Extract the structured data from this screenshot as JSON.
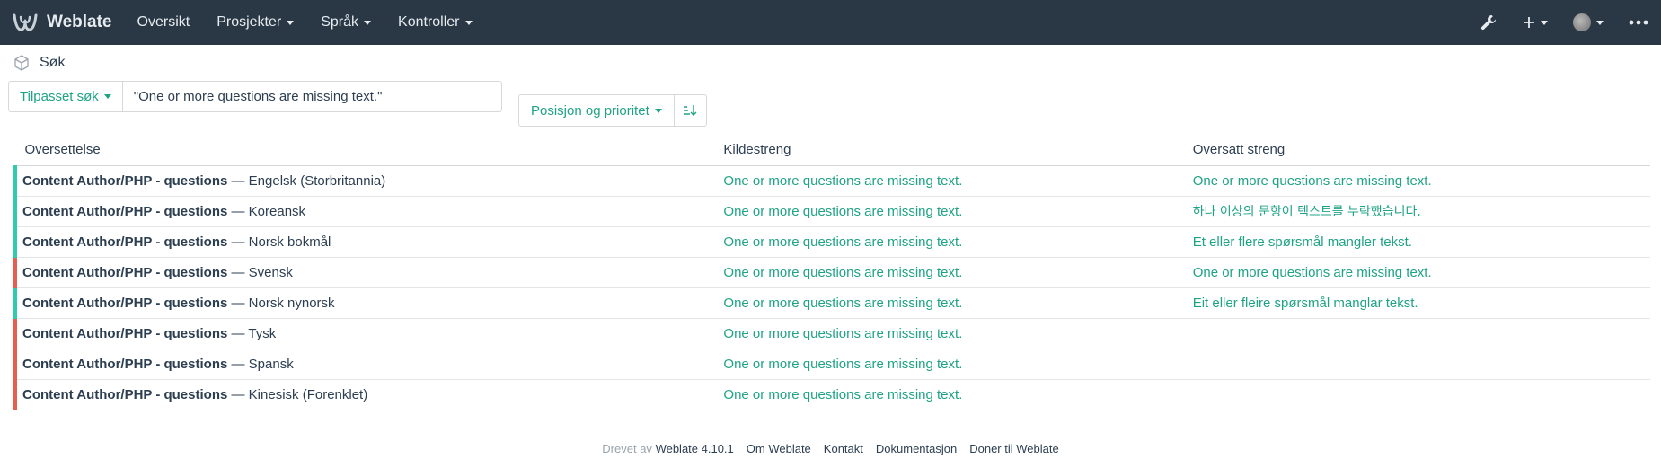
{
  "navbar": {
    "brand": "Weblate",
    "items": [
      {
        "label": "Oversikt",
        "dropdown": false
      },
      {
        "label": "Prosjekter",
        "dropdown": true
      },
      {
        "label": "Språk",
        "dropdown": true
      },
      {
        "label": "Kontroller",
        "dropdown": true
      }
    ],
    "right_icons": [
      "wrench-icon",
      "plus-icon",
      "avatar",
      "more-icon"
    ]
  },
  "breadcrumb": {
    "icon": "cube-icon",
    "label": "Søk"
  },
  "search": {
    "custom_search_label": "Tilpasset søk",
    "query_value": "\"One or more questions are missing text.\"",
    "sort_label": "Posisjon og prioritet",
    "sort_direction_icon": "sort-ascending-icon"
  },
  "table": {
    "headers": [
      "Oversettelse",
      "Kildestreng",
      "Oversatt streng"
    ],
    "separator": " — ",
    "rows": [
      {
        "component": "Content Author/PHP - questions",
        "language": "Engelsk (Storbritannia)",
        "source": "One or more questions are missing text.",
        "translation": "One or more questions are missing text.",
        "status": "translated"
      },
      {
        "component": "Content Author/PHP - questions",
        "language": "Koreansk",
        "source": "One or more questions are missing text.",
        "translation": "하나 이상의 문항이 텍스트를 누락했습니다.",
        "status": "translated"
      },
      {
        "component": "Content Author/PHP - questions",
        "language": "Norsk bokmål",
        "source": "One or more questions are missing text.",
        "translation": "Et eller flere spørsmål mangler tekst.",
        "status": "translated"
      },
      {
        "component": "Content Author/PHP - questions",
        "language": "Svensk",
        "source": "One or more questions are missing text.",
        "translation": "One or more questions are missing text.",
        "status": "needs-attention"
      },
      {
        "component": "Content Author/PHP - questions",
        "language": "Norsk nynorsk",
        "source": "One or more questions are missing text.",
        "translation": "Eit eller fleire spørsmål manglar tekst.",
        "status": "translated"
      },
      {
        "component": "Content Author/PHP - questions",
        "language": "Tysk",
        "source": "One or more questions are missing text.",
        "translation": "",
        "status": "needs-attention"
      },
      {
        "component": "Content Author/PHP - questions",
        "language": "Spansk",
        "source": "One or more questions are missing text.",
        "translation": "",
        "status": "needs-attention"
      },
      {
        "component": "Content Author/PHP - questions",
        "language": "Kinesisk (Forenklet)",
        "source": "One or more questions are missing text.",
        "translation": "",
        "status": "needs-attention"
      }
    ]
  },
  "footer": {
    "powered_by": "Drevet av",
    "version": "Weblate 4.10.1",
    "links": [
      "Om Weblate",
      "Kontakt",
      "Dokumentasjon",
      "Doner til Weblate"
    ]
  },
  "colors": {
    "navbar_bg": "#2a3744",
    "accent": "#1fa385",
    "translated": "#2eccaa",
    "needs_attention": "#e65e4f"
  }
}
